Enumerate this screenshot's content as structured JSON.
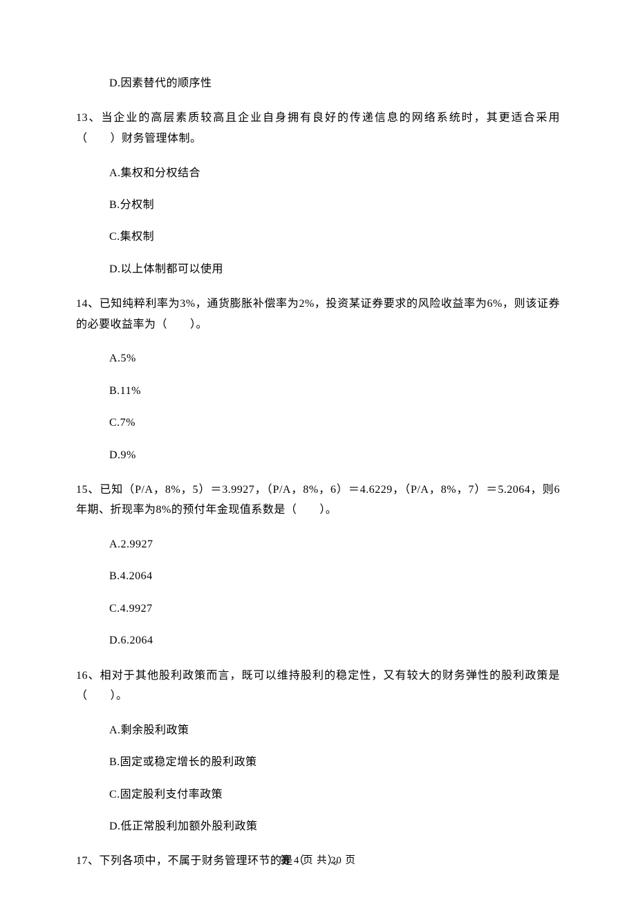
{
  "q12": {
    "opt_d": "D.因素替代的顺序性"
  },
  "q13": {
    "stem": "13、当企业的高层素质较高且企业自身拥有良好的传递信息的网络系统时，其更适合采用（　　）财务管理体制。",
    "opt_a": "A.集权和分权结合",
    "opt_b": "B.分权制",
    "opt_c": "C.集权制",
    "opt_d": "D.以上体制都可以使用"
  },
  "q14": {
    "stem": "14、已知纯粹利率为3%，通货膨胀补偿率为2%，投资某证券要求的风险收益率为6%，则该证券的必要收益率为（　　）。",
    "opt_a": "A.5%",
    "opt_b": "B.11%",
    "opt_c": "C.7%",
    "opt_d": "D.9%"
  },
  "q15": {
    "stem": "15、已知（P/A，8%，5）＝3.9927，（P/A，8%，6）＝4.6229，（P/A，8%，7）＝5.2064，则6年期、折现率为8%的预付年金现值系数是（　　）。",
    "opt_a": "A.2.9927",
    "opt_b": "B.4.2064",
    "opt_c": "C.4.9927",
    "opt_d": "D.6.2064"
  },
  "q16": {
    "stem": "16、相对于其他股利政策而言，既可以维持股利的稳定性，又有较大的财务弹性的股利政策是（　　）。",
    "opt_a": "A.剩余股利政策",
    "opt_b": "B.固定或稳定增长的股利政策",
    "opt_c": "C.固定股利支付率政策",
    "opt_d": "D.低正常股利加额外股利政策"
  },
  "q17": {
    "stem": "17、下列各项中，不属于财务管理环节的是（　　）。"
  },
  "footer": "第 4 页 共 20 页"
}
